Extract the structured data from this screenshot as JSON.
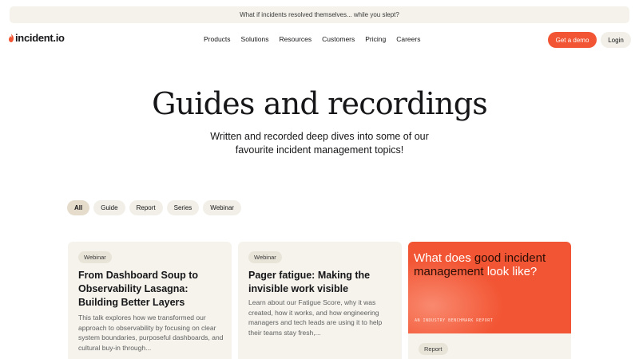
{
  "banner": {
    "text": "What if incidents resolved themselves... while you slept?"
  },
  "nav": {
    "logo": "incident.io",
    "items": [
      "Products",
      "Solutions",
      "Resources",
      "Customers",
      "Pricing",
      "Careers"
    ],
    "demo_label": "Get a demo",
    "login_label": "Login"
  },
  "hero": {
    "title": "Guides and recordings",
    "subtitle": "Written and recorded deep dives into some of our favourite incident management topics!"
  },
  "filters": [
    "All",
    "Guide",
    "Report",
    "Series",
    "Webinar"
  ],
  "cards": [
    {
      "tag": "Webinar",
      "title": "From Dashboard Soup to Observability Lasagna: Building Better Layers",
      "description": "This talk explores how we transformed our approach to observability by focusing on clear system boundaries, purposeful dashboards, and cultural buy-in through..."
    },
    {
      "tag": "Webinar",
      "title": "Pager fatigue: Making the invisible work visible",
      "description": "Learn about our Fatigue Score, why it was created, how it works, and how engineering managers and tech leads are using it to help their teams stay fresh,..."
    }
  ],
  "feature_card": {
    "heading_part1": "What does ",
    "heading_part2": "good incident",
    "heading_part3": "management",
    "heading_part4": " look like?",
    "small_label": "AN INDUSTRY BENCHMARK REPORT",
    "tag": "Report"
  },
  "colors": {
    "accent": "#f25533",
    "chip_bg": "#f1efe7",
    "card_bg": "#f5f3ec"
  }
}
